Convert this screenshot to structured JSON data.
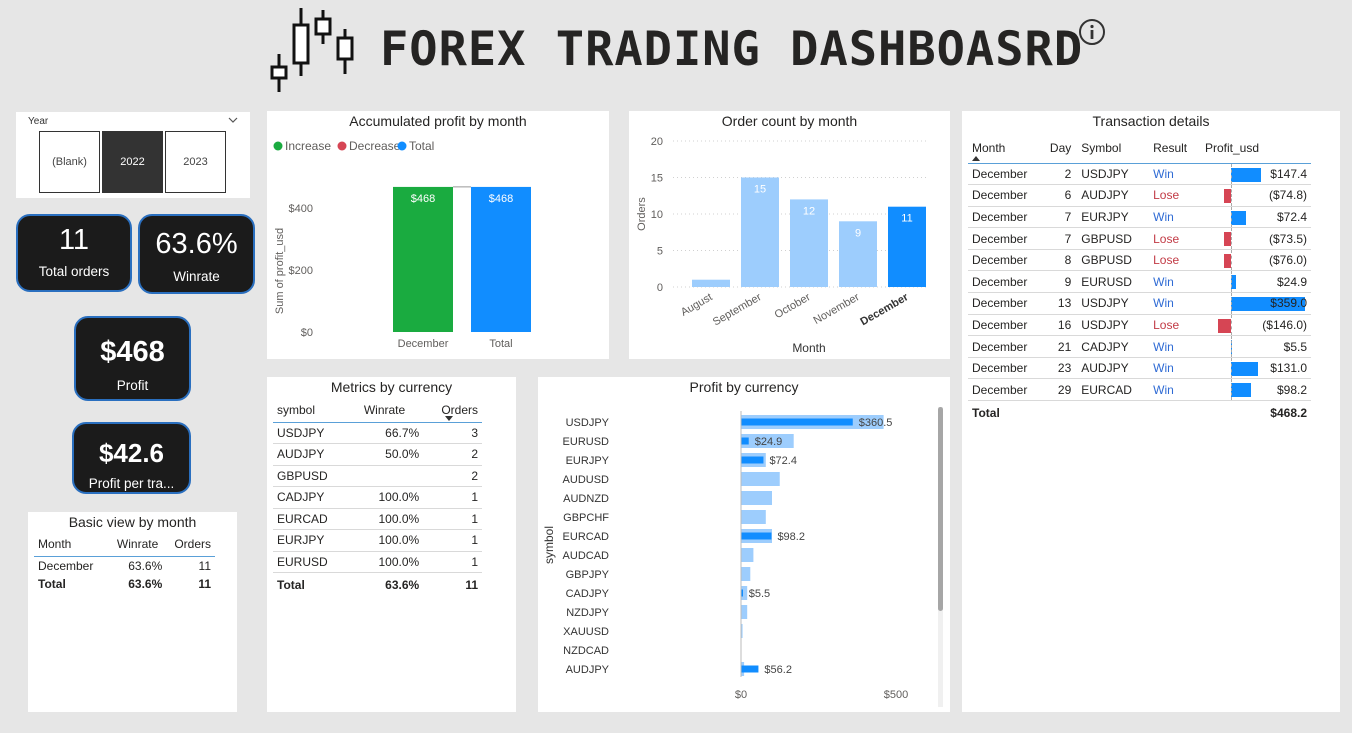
{
  "header": {
    "title": "FOREX TRADING DASHBOASRD"
  },
  "slicer": {
    "label": "Year",
    "options": [
      "(Blank)",
      "2022",
      "2023"
    ],
    "selected": "2022"
  },
  "kpis": {
    "total_orders": {
      "value": "11",
      "label": "Total orders"
    },
    "winrate": {
      "value": "63.6%",
      "label": "Winrate"
    },
    "profit": {
      "value": "$468",
      "label": "Profit"
    },
    "profit_per_trade": {
      "value": "$42.6",
      "label": "Profit per tra..."
    }
  },
  "basic_view": {
    "title": "Basic view by month",
    "headers": [
      "Month",
      "Winrate",
      "Orders"
    ],
    "rows": [
      [
        "December",
        "63.6%",
        "11"
      ]
    ],
    "total": [
      "Total",
      "63.6%",
      "11"
    ]
  },
  "metrics": {
    "title": "Metrics by currency",
    "headers": [
      "symbol",
      "Winrate",
      "Orders"
    ],
    "rows": [
      [
        "USDJPY",
        "66.7%",
        "3"
      ],
      [
        "AUDJPY",
        "50.0%",
        "2"
      ],
      [
        "GBPUSD",
        "",
        "2"
      ],
      [
        "CADJPY",
        "100.0%",
        "1"
      ],
      [
        "EURCAD",
        "100.0%",
        "1"
      ],
      [
        "EURJPY",
        "100.0%",
        "1"
      ],
      [
        "EURUSD",
        "100.0%",
        "1"
      ]
    ],
    "total": [
      "Total",
      "63.6%",
      "11"
    ]
  },
  "transactions": {
    "title": "Transaction details",
    "headers": [
      "Month",
      "Day",
      "Symbol",
      "Result",
      "Profit_usd"
    ],
    "rows": [
      [
        "December",
        "2",
        "USDJPY",
        "Win",
        "$147.4"
      ],
      [
        "December",
        "6",
        "AUDJPY",
        "Lose",
        "($74.8)"
      ],
      [
        "December",
        "7",
        "EURJPY",
        "Win",
        "$72.4"
      ],
      [
        "December",
        "7",
        "GBPUSD",
        "Lose",
        "($73.5)"
      ],
      [
        "December",
        "8",
        "GBPUSD",
        "Lose",
        "($76.0)"
      ],
      [
        "December",
        "9",
        "EURUSD",
        "Win",
        "$24.9"
      ],
      [
        "December",
        "13",
        "USDJPY",
        "Win",
        "$359.0"
      ],
      [
        "December",
        "16",
        "USDJPY",
        "Lose",
        "($146.0)"
      ],
      [
        "December",
        "21",
        "CADJPY",
        "Win",
        "$5.5"
      ],
      [
        "December",
        "23",
        "AUDJPY",
        "Win",
        "$131.0"
      ],
      [
        "December",
        "29",
        "EURCAD",
        "Win",
        "$98.2"
      ]
    ],
    "profit_values": [
      147.4,
      -74.8,
      72.4,
      -73.5,
      -76.0,
      24.9,
      359.0,
      -146.0,
      5.5,
      131.0,
      98.2
    ],
    "total": [
      "Total",
      "",
      "",
      "",
      "$468.2"
    ]
  },
  "colors": {
    "increase": "#1aab40",
    "decrease": "#d64554",
    "total": "#118dff",
    "light_bar": "#9dcdfd",
    "kpi_bg": "#1b1b1b",
    "kpi_border": "#2a6fbf"
  },
  "chart_data": [
    {
      "id": "accumulated",
      "type": "bar",
      "title": "Accumulated profit by month",
      "legend": [
        "Increase",
        "Decrease",
        "Total"
      ],
      "legend_position": "top-left",
      "categories": [
        "December",
        "Total"
      ],
      "values": [
        468,
        468
      ],
      "bar_types": [
        "increase",
        "total"
      ],
      "data_labels": [
        "$468",
        "$468"
      ],
      "ylabel": "Sum of profit_usd",
      "yticks": [
        "$0",
        "$200",
        "$400"
      ],
      "ytick_values": [
        0,
        200,
        400
      ],
      "ylim": [
        0,
        500
      ]
    },
    {
      "id": "order_count",
      "type": "bar",
      "title": "Order count by month",
      "categories": [
        "August",
        "September",
        "October",
        "November",
        "December"
      ],
      "values": [
        1,
        15,
        12,
        9,
        11
      ],
      "data_labels": [
        "",
        "15",
        "12",
        "9",
        "11"
      ],
      "highlighted": "December",
      "xlabel": "Month",
      "ylabel": "Orders",
      "yticks": [
        "0",
        "5",
        "10",
        "15",
        "20"
      ],
      "ytick_values": [
        0,
        5,
        10,
        15,
        20
      ],
      "ylim": [
        0,
        20
      ],
      "grid": true
    },
    {
      "id": "profit_currency",
      "type": "bar",
      "orientation": "horizontal",
      "title": "Profit by currency",
      "categories": [
        "USDJPY",
        "EURUSD",
        "EURJPY",
        "AUDUSD",
        "AUDNZD",
        "GBPCHF",
        "EURCAD",
        "AUDCAD",
        "GBPJPY",
        "CADJPY",
        "NZDJPY",
        "XAUUSD",
        "NZDCAD",
        "AUDJPY"
      ],
      "values": [
        360.5,
        24.9,
        72.4,
        null,
        null,
        null,
        98.2,
        null,
        null,
        5.5,
        null,
        null,
        null,
        56.2
      ],
      "data_labels": [
        "$360.5",
        "$24.9",
        "$72.4",
        "",
        "",
        "",
        "$98.2",
        "",
        "",
        "$5.5",
        "",
        "",
        "",
        "$56.2"
      ],
      "background_values": [
        460,
        170,
        80,
        125,
        100,
        80,
        100,
        40,
        30,
        20,
        20,
        5,
        0,
        10
      ],
      "ylabel": "symbol",
      "xticks": [
        "$0",
        "$500"
      ],
      "xtick_values": [
        0,
        500
      ],
      "xlim": [
        0,
        500
      ]
    }
  ]
}
